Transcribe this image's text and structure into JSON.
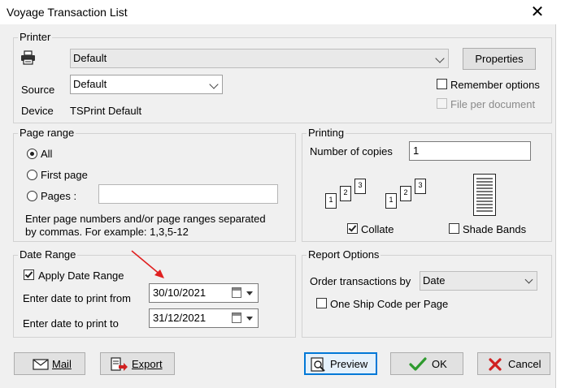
{
  "window": {
    "title": "Voyage Transaction List",
    "close_glyph": "✕"
  },
  "printer": {
    "legend": "Printer",
    "selected": "Default",
    "properties_label": "Properties",
    "source_label": "Source",
    "source_value": "Default",
    "device_label": "Device",
    "device_value": "TSPrint Default",
    "remember_options_label": "Remember options",
    "remember_options_checked": false,
    "file_per_document_label": "File per document",
    "file_per_document_checked": false
  },
  "page_range": {
    "legend": "Page range",
    "all_label": "All",
    "first_page_label": "First page",
    "pages_label": "Pages :",
    "pages_value": "",
    "selected": "All",
    "hint_line1": "Enter page numbers and/or page ranges separated",
    "hint_line2": "by commas. For example: 1,3,5-12"
  },
  "printing": {
    "legend": "Printing",
    "copies_label": "Number of copies",
    "copies_value": "1",
    "collate_label": "Collate",
    "collate_checked": true,
    "shade_bands_label": "Shade Bands",
    "shade_bands_checked": false
  },
  "date_range": {
    "legend": "Date Range",
    "apply_label": "Apply Date Range",
    "apply_checked": true,
    "from_label": "Enter date to print from",
    "from_value": "30/10/2021",
    "to_label": "Enter date to print to",
    "to_value": "31/12/2021"
  },
  "report_options": {
    "legend": "Report Options",
    "order_label": "Order transactions by",
    "order_value": "Date",
    "one_ship_label": "One Ship Code per Page",
    "one_ship_checked": false
  },
  "buttons": {
    "mail": "Mail",
    "export": "Export",
    "preview": "Preview",
    "ok": "OK",
    "cancel": "Cancel"
  },
  "colors": {
    "accent": "#0078d7",
    "annotation_arrow": "#e02020",
    "ok_check": "#2e9a2e",
    "cancel_x": "#d02020"
  }
}
